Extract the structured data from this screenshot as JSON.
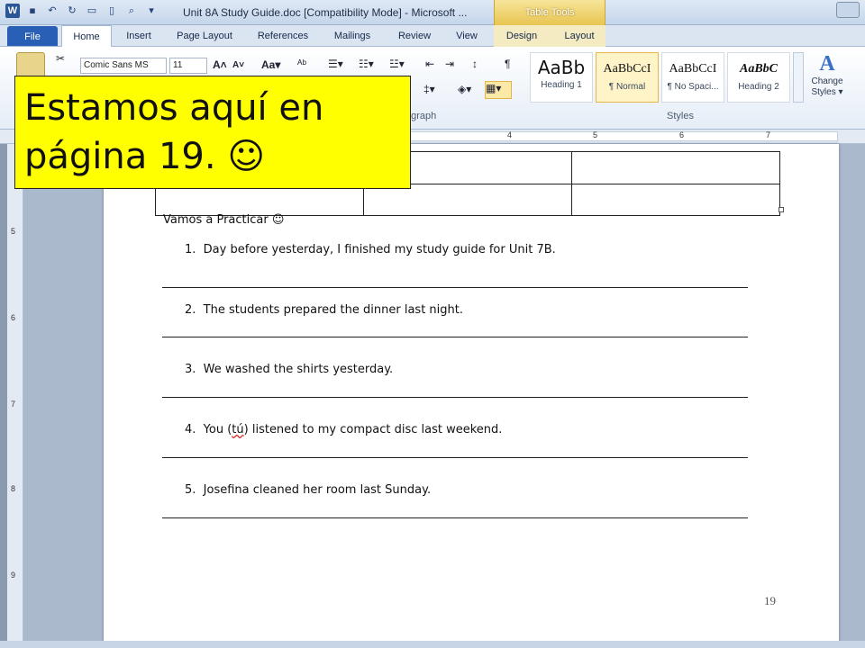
{
  "window": {
    "title": "Unit 8A Study Guide.doc [Compatibility Mode] - Microsoft ...",
    "context_tab_label": "Table Tools"
  },
  "tabs": [
    "File",
    "Home",
    "Insert",
    "Page Layout",
    "References",
    "Mailings",
    "Review",
    "View",
    "Design",
    "Layout"
  ],
  "ribbon": {
    "font_name": "Comic Sans MS",
    "font_size": "11",
    "paragraph_group_label": "agraph",
    "styles_group_label": "Styles",
    "styles": [
      {
        "sample": "AaBb",
        "name": "Heading 1"
      },
      {
        "sample": "AaBbCcI",
        "name": "¶ Normal"
      },
      {
        "sample": "AaBbCcI",
        "name": "¶ No Spaci..."
      },
      {
        "sample": "AaBbC",
        "name": "Heading 2"
      }
    ],
    "change_styles": {
      "line1": "Change",
      "line2": "Styles ▾"
    }
  },
  "ruler": {
    "numbers": [
      "4",
      "5",
      "6",
      "7"
    ]
  },
  "vruler": {
    "numbers": [
      "5",
      "6",
      "7",
      "8",
      "9"
    ]
  },
  "document": {
    "practice_heading": "Vamos a Practicar ☺",
    "items": [
      {
        "num": "1.",
        "text": "Day before yesterday, I finished my study guide for Unit 7B."
      },
      {
        "num": "2.",
        "text": "The students prepared the dinner last night."
      },
      {
        "num": "3.",
        "text": "We washed the shirts yesterday."
      },
      {
        "num": "4.",
        "text_before": "You (",
        "misspelled": "tú",
        "text_after": ") listened to my compact disc last weekend."
      },
      {
        "num": "5.",
        "text": "Josefina cleaned her room last Sunday."
      }
    ],
    "page_number": "19"
  },
  "overlay": {
    "line1": "Estamos  aquí en",
    "line2": "página 19.  ☺"
  }
}
